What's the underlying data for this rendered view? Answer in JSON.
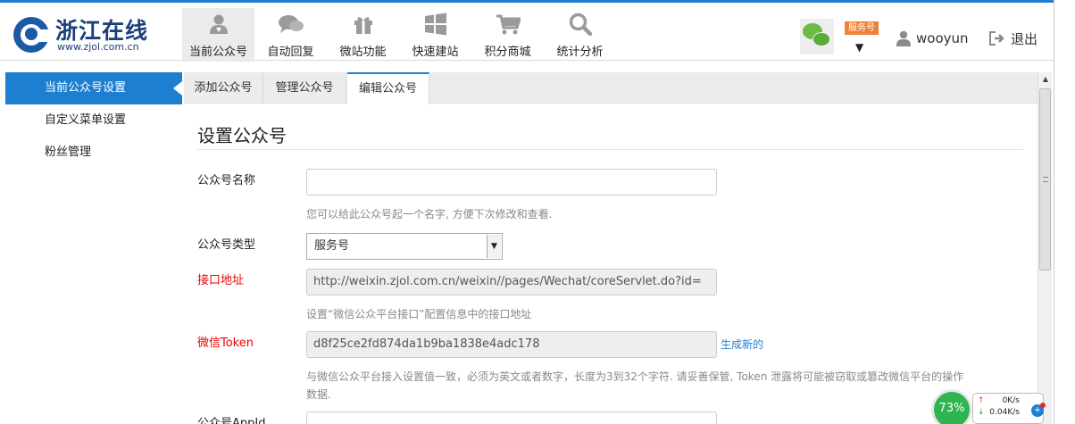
{
  "app": {
    "logo_title": "浙江在线",
    "logo_url": "www.zjol.com.cn"
  },
  "nav": [
    {
      "label": "当前公众号",
      "icon": "user-icon",
      "active": true
    },
    {
      "label": "自动回复",
      "icon": "chat-bubbles-icon"
    },
    {
      "label": "微站功能",
      "icon": "gift-icon"
    },
    {
      "label": "快速建站",
      "icon": "windows-icon"
    },
    {
      "label": "积分商城",
      "icon": "shopping-cart-icon"
    },
    {
      "label": "统计分析",
      "icon": "search-icon"
    }
  ],
  "account": {
    "type_badge": "服务号",
    "dropdown_arrow": "▼",
    "username": "wooyun",
    "logout_label": "退出"
  },
  "sidebar": [
    {
      "label": "当前公众号设置",
      "active": true
    },
    {
      "label": "自定义菜单设置"
    },
    {
      "label": "粉丝管理"
    }
  ],
  "tabs": [
    {
      "label": "添加公众号"
    },
    {
      "label": "管理公众号"
    },
    {
      "label": "编辑公众号",
      "active": true
    }
  ],
  "form": {
    "title": "设置公众号",
    "name_label": "公众号名称",
    "name_value": "",
    "name_hint": "您可以给此公众号起一个名字, 方便下次修改和查看.",
    "type_label": "公众号类型",
    "type_value": "服务号",
    "url_label": "接口地址",
    "url_value": "http://weixin.zjol.com.cn/weixin//pages/Wechat/coreServlet.do?id=",
    "url_hint": "设置“微信公众平台接口”配置信息中的接口地址",
    "token_label": "微信Token",
    "token_value": "d8f25ce2fd874da1b9ba1838e4adc178",
    "token_generate": "生成新的",
    "token_hint_1": "与微信公众平台接入设置值一致，必须为英文或者数字，长度为3到32个字符. 请妥善保管, Token 泄露将可能被窃取或篡改微信平台的操作",
    "token_hint_2": "数据.",
    "appid_label": "公众号AppId",
    "appid_value": ""
  },
  "net_widget": {
    "percent": "73%",
    "upload": "0K/s",
    "download": "0.04K/s"
  },
  "colors": {
    "accent": "#1e7fd0",
    "required_label": "#ee0000",
    "badge": "#f08137"
  }
}
